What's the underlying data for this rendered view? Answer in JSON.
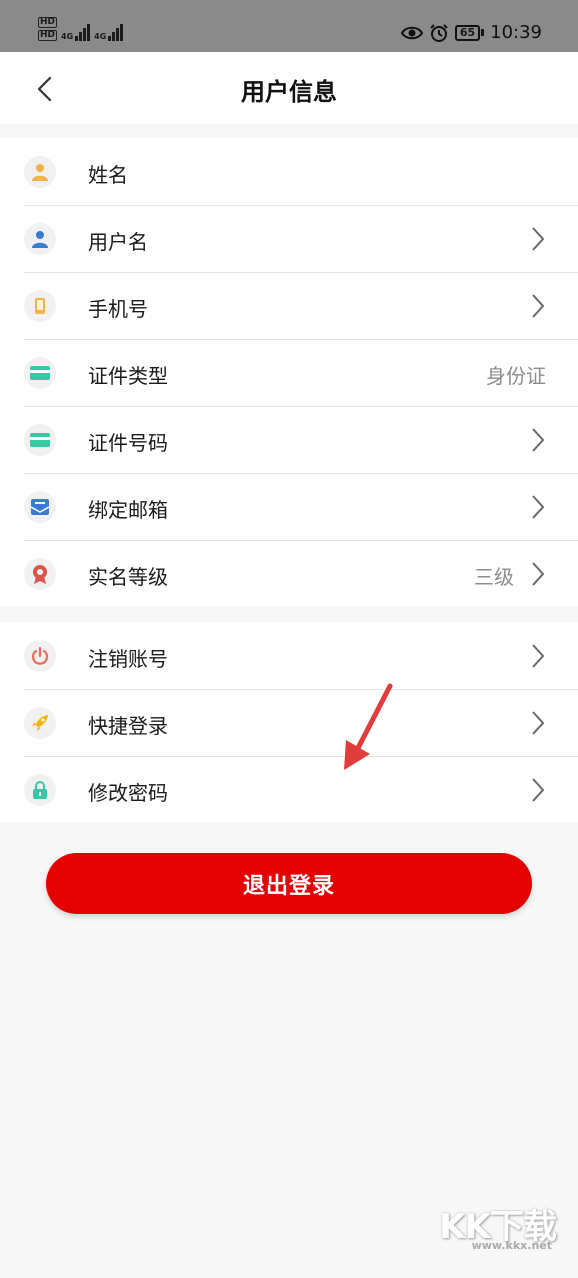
{
  "status_bar": {
    "hd1": "HD",
    "hd2": "HD",
    "net1": "4G",
    "net2": "4G",
    "battery": "65",
    "time": "10:39"
  },
  "header": {
    "title": "用户信息"
  },
  "profile_items": [
    {
      "label": "姓名",
      "value": "",
      "icon": "person-icon",
      "icon_color": "#f3b24a"
    },
    {
      "label": "用户名",
      "value": "",
      "icon": "user-icon",
      "icon_color": "#3a7bd5"
    },
    {
      "label": "手机号",
      "value": "",
      "icon": "phone-icon",
      "icon_color": "#f3b24a"
    },
    {
      "label": "证件类型",
      "value": "身份证",
      "icon": "card-icon",
      "icon_color": "#35c9a6"
    },
    {
      "label": "证件号码",
      "value": "",
      "icon": "card-icon",
      "icon_color": "#35c9a6"
    },
    {
      "label": "绑定邮箱",
      "value": "",
      "icon": "mail-icon",
      "icon_color": "#3a7bd5"
    },
    {
      "label": "实名等级",
      "value": "三级",
      "icon": "badge-icon",
      "icon_color": "#e0514a"
    }
  ],
  "account_items": [
    {
      "label": "注销账号",
      "icon": "power-icon",
      "icon_color": "#ef6c57"
    },
    {
      "label": "快捷登录",
      "icon": "rocket-icon",
      "icon_color": "#f4b400"
    },
    {
      "label": "修改密码",
      "icon": "lock-icon",
      "icon_color": "#35c9a6"
    }
  ],
  "logout_label": "退出登录",
  "watermark": {
    "logo": "KK下载",
    "url": "www.kkx.net"
  }
}
